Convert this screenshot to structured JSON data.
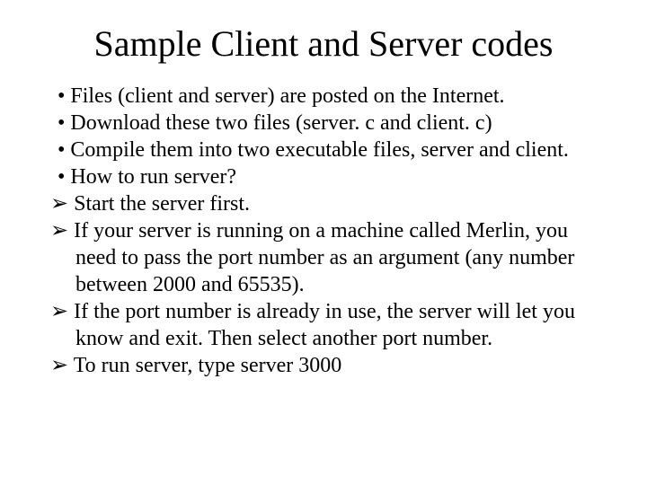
{
  "title": "Sample Client and Server codes",
  "bullets": {
    "b1": "Files (client and server) are posted on the Internet.",
    "b2": "Download these two files (server. c and client. c)",
    "b3": "Compile them into two executable files, server and client.",
    "b4": "How to run server?",
    "a1": "Start the server first.",
    "a2": "If your server is running on a machine called Merlin, you need to pass the port number as an argument (any number between 2000 and 65535).",
    "a3": "If the port number is already in use, the server will let you know and exit. Then select another port number.",
    "a4": "To run server, type server 3000"
  }
}
